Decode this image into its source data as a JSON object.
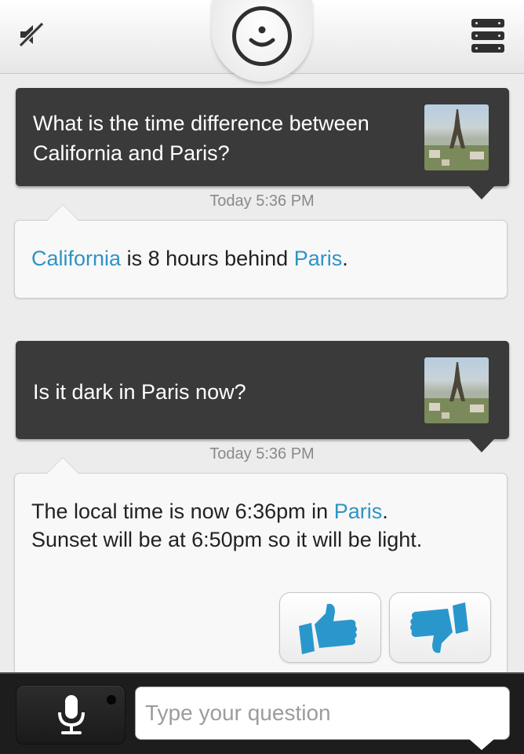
{
  "header": {
    "mute_icon": "mute-speaker-icon",
    "assistant_icon": "smiley-face-icon",
    "menu_icon": "stack-menu-icon"
  },
  "conversation": [
    {
      "question": "What is the time difference between California and Paris?",
      "question_image": "eiffel-tower-thumbnail",
      "timestamp": "Today 5:36 PM",
      "answer": {
        "parts": [
          "California",
          " is 8 hours behind ",
          "Paris",
          "."
        ],
        "links": [
          "California",
          "Paris"
        ]
      }
    },
    {
      "question": "Is it dark in Paris now?",
      "question_image": "eiffel-tower-thumbnail",
      "timestamp": "Today 5:36 PM",
      "answer": {
        "parts": [
          "The local time is now 6:36pm in ",
          "Paris",
          ".",
          "Sunset will be at 6:50pm so it will be light."
        ],
        "links": [
          "Paris"
        ]
      },
      "feedback": {
        "like_icon": "thumbs-up-icon",
        "dislike_icon": "thumbs-down-icon"
      }
    }
  ],
  "input": {
    "placeholder": "Type your question",
    "mic_icon": "microphone-icon"
  },
  "colors": {
    "link": "#2e94c4",
    "question_bubble": "#3a3a3a",
    "bottom_bar": "#1d1d1d"
  }
}
